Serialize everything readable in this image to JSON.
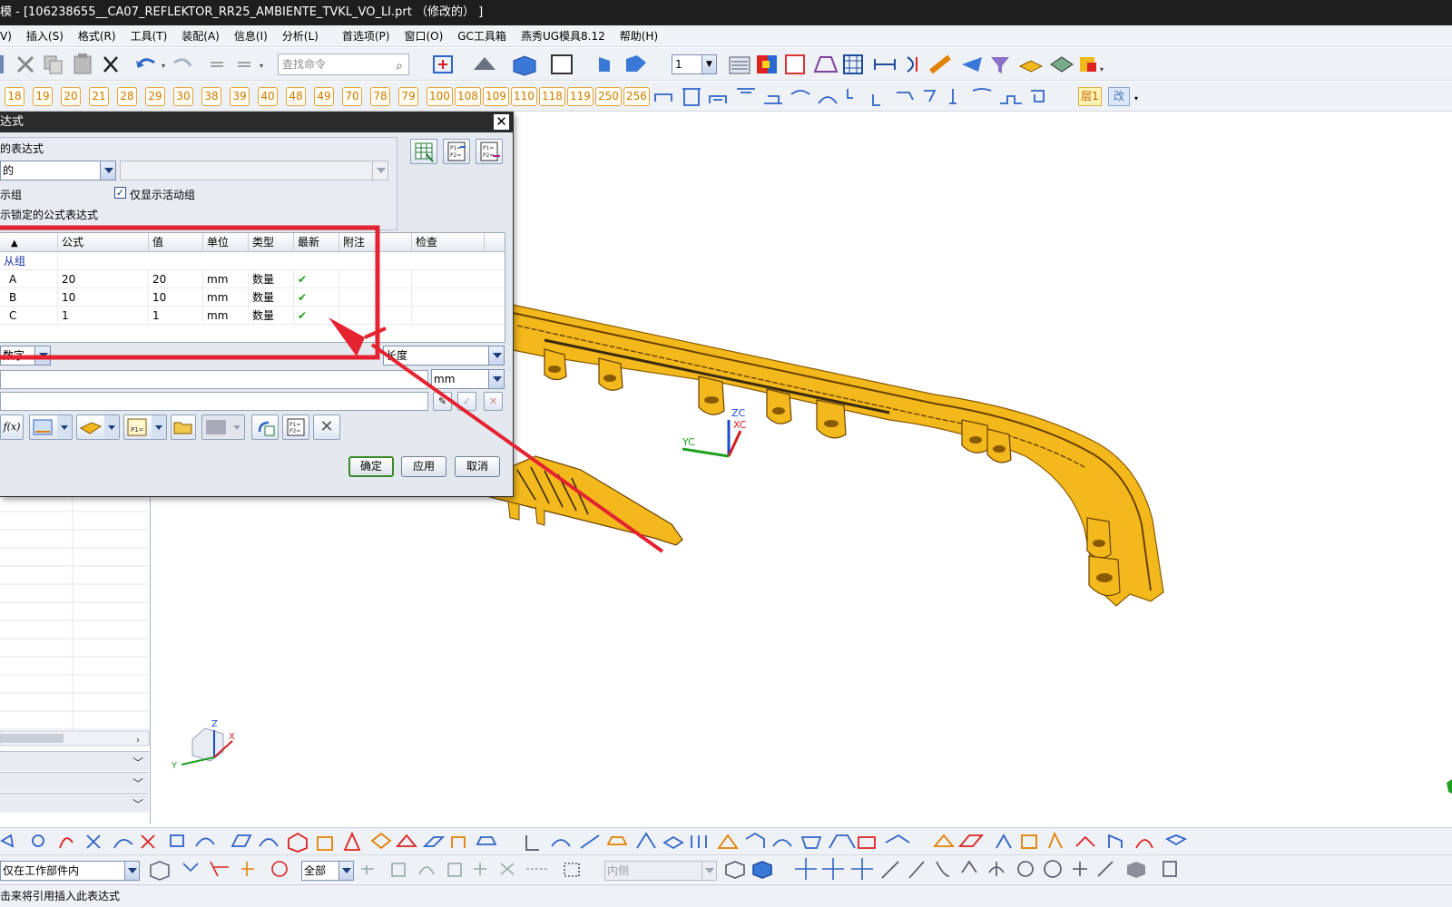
{
  "window": {
    "title": "模 - [106238655__CA07_REFLEKTOR_RR25_AMBIENTE_TVKL_VO_LI.prt （修改的） ]"
  },
  "menu": {
    "items": [
      "V)",
      "插入(S)",
      "格式(R)",
      "工具(T)",
      "装配(A)",
      "信息(I)",
      "分析(L)",
      "首选项(P)",
      "窗口(O)",
      "GC工具箱",
      "燕秀UG模具8.12",
      "帮助(H)"
    ]
  },
  "toolbar1": {
    "search_placeholder": "查找命令",
    "layer_value": "1"
  },
  "toolbar2": {
    "layer_buttons": [
      "18",
      "19",
      "20",
      "21",
      "28",
      "29",
      "30",
      "38",
      "39",
      "40",
      "48",
      "49",
      "70",
      "78",
      "79",
      "100",
      "108",
      "109",
      "110",
      "118",
      "119",
      "250",
      "256"
    ],
    "layer_label": "层1",
    "modify_label": "改"
  },
  "dialog": {
    "title": "达式",
    "section_label": "的表达式",
    "filter_value": "的",
    "show_groups_label": "示组",
    "active_group_label": "仅显示活动组",
    "active_group_checked": true,
    "locked_formula_label": "示锁定的公式表达式",
    "table": {
      "columns": [
        "",
        "公式",
        "值",
        "单位",
        "类型",
        "最新",
        "附注",
        "检查"
      ],
      "group_row": "从组",
      "rows": [
        {
          "name": "A",
          "formula": "20",
          "value": "20",
          "unit": "mm",
          "type": "数量",
          "uptodate": "✔"
        },
        {
          "name": "B",
          "formula": "10",
          "value": "10",
          "unit": "mm",
          "type": "数量",
          "uptodate": "✔"
        },
        {
          "name": "C",
          "formula": "1",
          "value": "1",
          "unit": "mm",
          "type": "数量",
          "uptodate": "✔"
        }
      ]
    },
    "type_value": "数字",
    "dimension_value": "长度",
    "unit_value": "mm",
    "fx_label": "f(x)",
    "buttons": {
      "ok": "确定",
      "apply": "应用",
      "cancel": "取消"
    }
  },
  "viewport": {
    "wcs_labels": {
      "zc": "ZC",
      "xc": "XC",
      "yc": "YC"
    },
    "triad": {
      "z": "Z",
      "x": "X",
      "y": "Y"
    }
  },
  "bottom": {
    "scope_value": "仅在工作部件内",
    "filter_value": "全部",
    "disabled_value": "内侧"
  },
  "status": {
    "text": "击来将引用插入此表达式"
  },
  "colors": {
    "part": "#f2b81c",
    "part_edge": "#8a5a00",
    "annotation": "#e42230"
  }
}
